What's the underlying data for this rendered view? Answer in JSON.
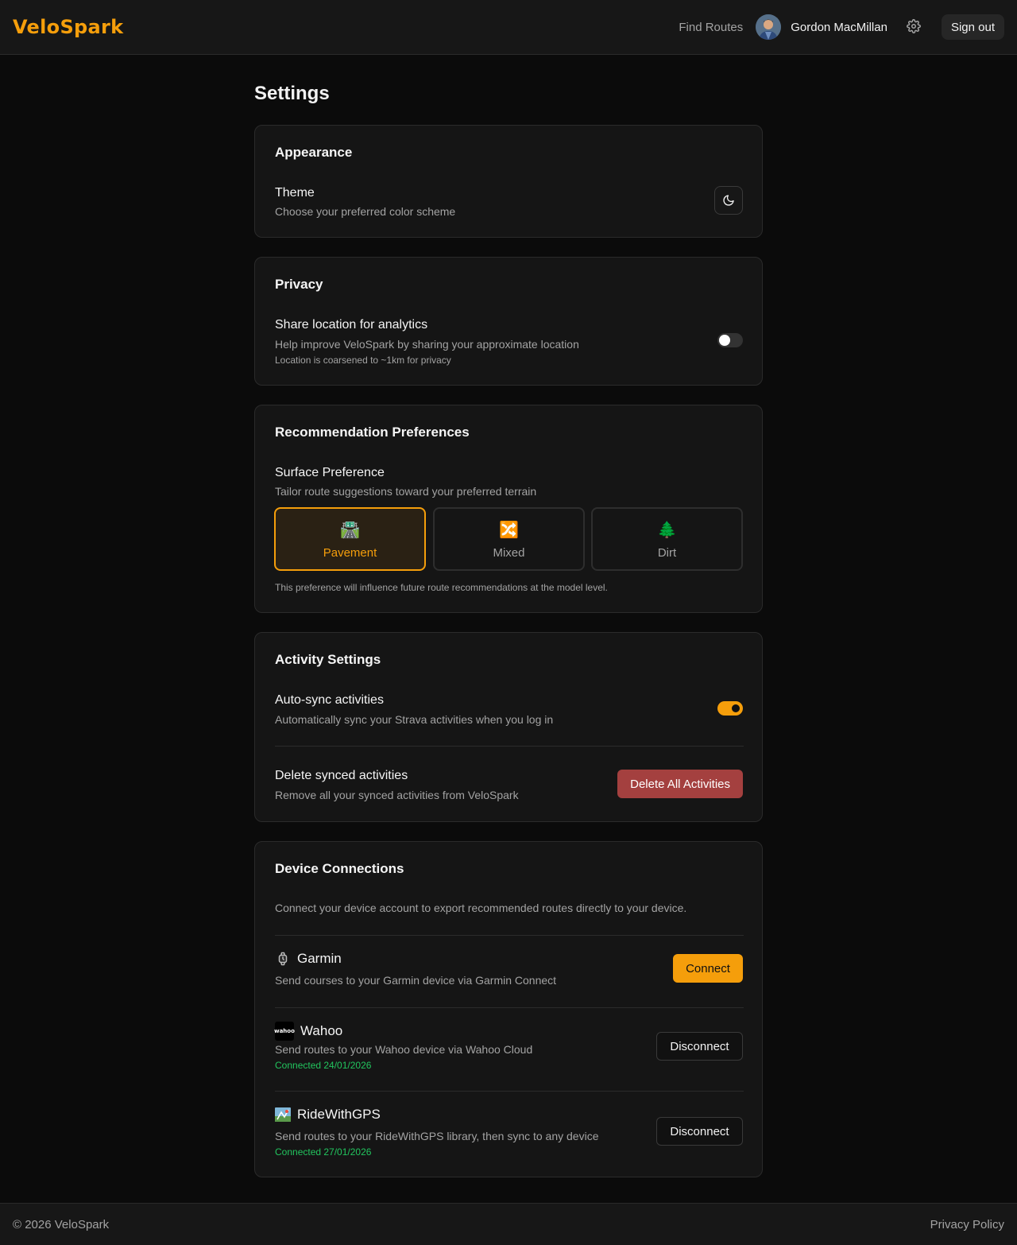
{
  "app": {
    "logo": "VeloSpark"
  },
  "header": {
    "find_routes": "Find Routes",
    "user_name": "Gordon MacMillan",
    "sign_out": "Sign out"
  },
  "page": {
    "title": "Settings"
  },
  "appearance": {
    "title": "Appearance",
    "theme_title": "Theme",
    "theme_desc": "Choose your preferred color scheme",
    "theme_icon": "moon-icon"
  },
  "privacy": {
    "title": "Privacy",
    "share_title": "Share location for analytics",
    "share_desc": "Help improve VeloSpark by sharing your approximate location",
    "share_note": "Location is coarsened to ~1km for privacy",
    "share_enabled": false
  },
  "recommendation": {
    "title": "Recommendation Preferences",
    "surface_title": "Surface Preference",
    "surface_desc": "Tailor route suggestions toward your preferred terrain",
    "options": [
      {
        "emoji": "🛣️",
        "label": "Pavement",
        "selected": true
      },
      {
        "emoji": "🔀",
        "label": "Mixed",
        "selected": false
      },
      {
        "emoji": "🌲",
        "label": "Dirt",
        "selected": false
      }
    ],
    "note": "This preference will influence future route recommendations at the model level."
  },
  "activity": {
    "title": "Activity Settings",
    "autosync_title": "Auto-sync activities",
    "autosync_desc": "Automatically sync your Strava activities when you log in",
    "autosync_enabled": true,
    "delete_title": "Delete synced activities",
    "delete_desc": "Remove all your synced activities from VeloSpark",
    "delete_button": "Delete All Activities"
  },
  "devices": {
    "title": "Device Connections",
    "intro": "Connect your device account to export recommended routes directly to your device.",
    "items": [
      {
        "name": "Garmin",
        "icon": "watch-icon",
        "desc": "Send courses to your Garmin device via Garmin Connect",
        "status": "",
        "button": "Connect"
      },
      {
        "name": "Wahoo",
        "icon": "wahoo-logo",
        "icon_text": "wahoo",
        "desc": "Send routes to your Wahoo device via Wahoo Cloud",
        "status": "Connected 24/01/2026",
        "button": "Disconnect"
      },
      {
        "name": "RideWithGPS",
        "icon": "map-icon",
        "desc": "Send routes to your RideWithGPS library, then sync to any device",
        "status": "Connected 27/01/2026",
        "button": "Disconnect"
      }
    ]
  },
  "footer": {
    "copyright": "© 2026 VeloSpark",
    "privacy_policy": "Privacy Policy"
  },
  "colors": {
    "accent": "#f59e0b",
    "danger": "#a4403f",
    "connected": "#22c55e",
    "background": "#0b0b0b",
    "card": "#151515"
  }
}
